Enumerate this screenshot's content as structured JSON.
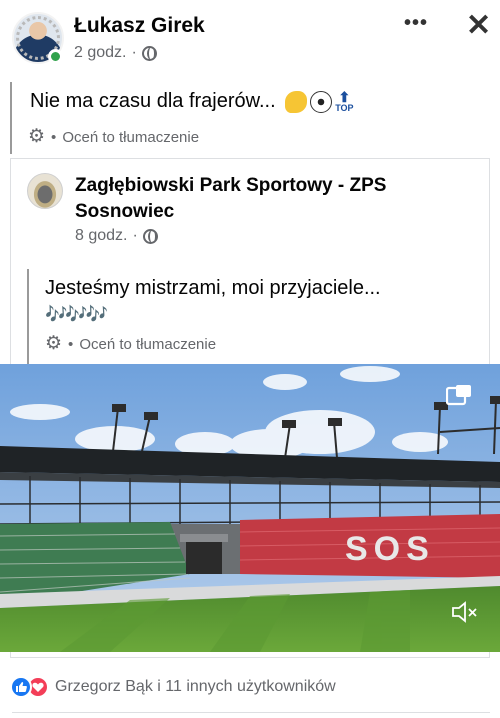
{
  "post": {
    "author": "Łukasz Girek",
    "time": "2 godz.",
    "separator": "·",
    "text": "Nie ma czasu dla frajerów...",
    "emoji_icons": [
      "flexed-biceps-icon",
      "soccer-ball-icon",
      "top-arrow-icon"
    ],
    "top_label": "TOP",
    "translate_label": "Oceń to tłumaczenie"
  },
  "shared": {
    "page_name": "Zagłębiowski Park Sportowy - ZPS Sosnowiec",
    "time": "8 godz.",
    "separator": "·",
    "text": "Jesteśmy mistrzami, moi przyjaciele...",
    "notes": "🎶🎶🎶",
    "translate_label": "Oceń to tłumaczenie",
    "stadium_letters": "SOS"
  },
  "reactions": {
    "icons": [
      "like-icon",
      "love-icon"
    ],
    "text": "Grzegorz Bąk i 11 innych użytkowników"
  },
  "colors": {
    "like": "#1877f2",
    "love": "#f33e58",
    "meta": "#65676b",
    "seats": "#c23a44"
  }
}
